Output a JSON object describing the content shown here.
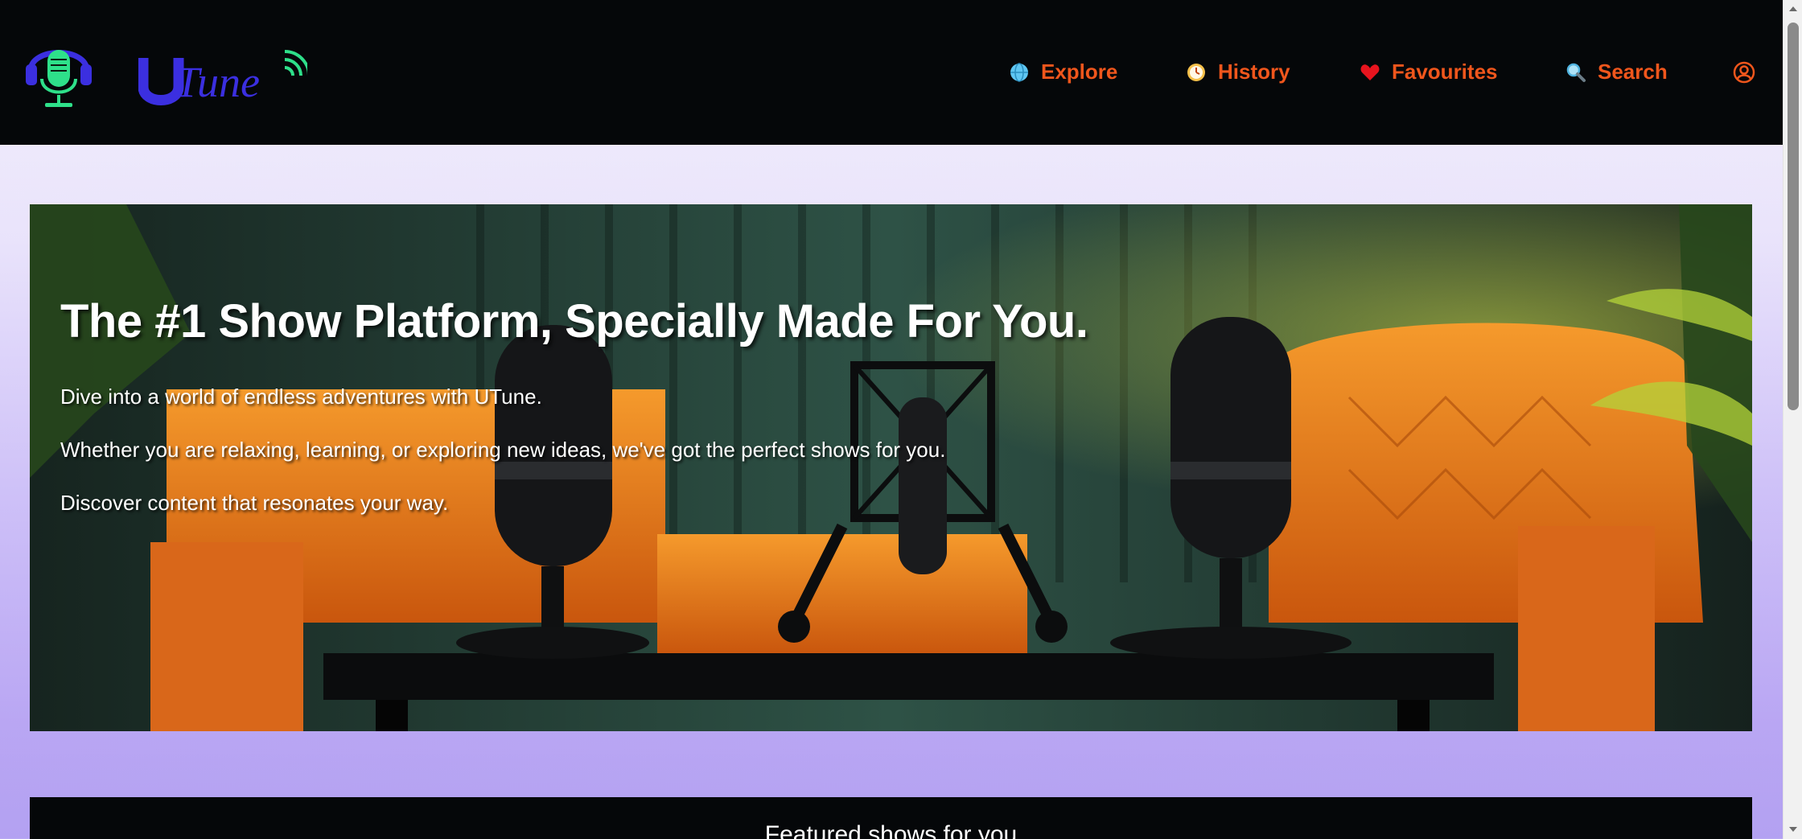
{
  "brand": {
    "name": "UTune",
    "logo_icon": "headphones-microphone-icon",
    "colors": {
      "accent": "#f0561c",
      "logo_blue": "#3b2fe0",
      "logo_green": "#2ee08a"
    }
  },
  "nav": {
    "items": [
      {
        "label": "Explore",
        "icon": "globe-icon"
      },
      {
        "label": "History",
        "icon": "clock-icon"
      },
      {
        "label": "Favourites",
        "icon": "heart-icon"
      },
      {
        "label": "Search",
        "icon": "search-icon"
      }
    ],
    "account_icon": "user-circle-icon"
  },
  "hero": {
    "title": "The #1 Show Platform, Specially Made For You.",
    "paragraphs": [
      "Dive into a world of endless adventures with UTune.",
      "Whether you are relaxing, learning, or exploring new ideas, we've got the perfect shows for you.",
      "Discover content that resonates your way."
    ]
  },
  "featured": {
    "title": "Featured shows for you"
  }
}
